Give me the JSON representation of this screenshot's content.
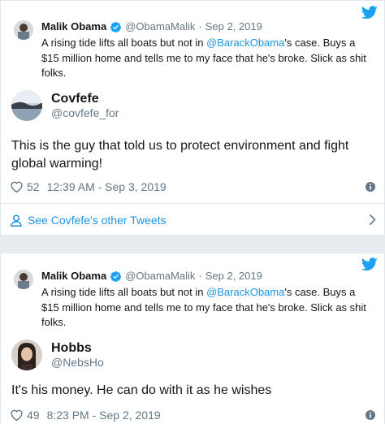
{
  "cards": [
    {
      "quoted": {
        "name": "Malik Obama",
        "handle": "@ObamaMalik",
        "separator": "·",
        "date": "Sep 2, 2019",
        "text_before": "A rising tide lifts all boats but not in ",
        "mention": "@BarackObama",
        "text_after": "'s case. Buys a $15 million home and tells me to my face that he's broke. Slick as shit folks."
      },
      "author": {
        "name": "Covfefe",
        "handle": "@covfefe_for"
      },
      "text": "This is the guy that told us to protect environment and fight global warming!",
      "likes": "52",
      "timestamp": "12:39 AM - Sep 3, 2019",
      "see_more": "See Covfefe's other Tweets"
    },
    {
      "quoted": {
        "name": "Malik Obama",
        "handle": "@ObamaMalik",
        "separator": "·",
        "date": "Sep 2, 2019",
        "text_before": "A rising tide lifts all boats but not in ",
        "mention": "@BarackObama",
        "text_after": "'s case. Buys a $15 million home and tells me to my face that he's broke. Slick as shit folks."
      },
      "author": {
        "name": "Hobbs",
        "handle": "@NebsHo"
      },
      "text": "It's his money. He can do with it as he wishes",
      "likes": "49",
      "timestamp": "8:23 PM - Sep 2, 2019"
    }
  ],
  "colors": {
    "link": "#1b95e0",
    "muted": "#657786",
    "border": "#e1e8ed",
    "background": "#e6ecf0"
  },
  "icons": [
    "twitter-logo-icon",
    "verified-badge-icon",
    "heart-icon",
    "info-icon",
    "person-icon",
    "chevron-right-icon"
  ]
}
